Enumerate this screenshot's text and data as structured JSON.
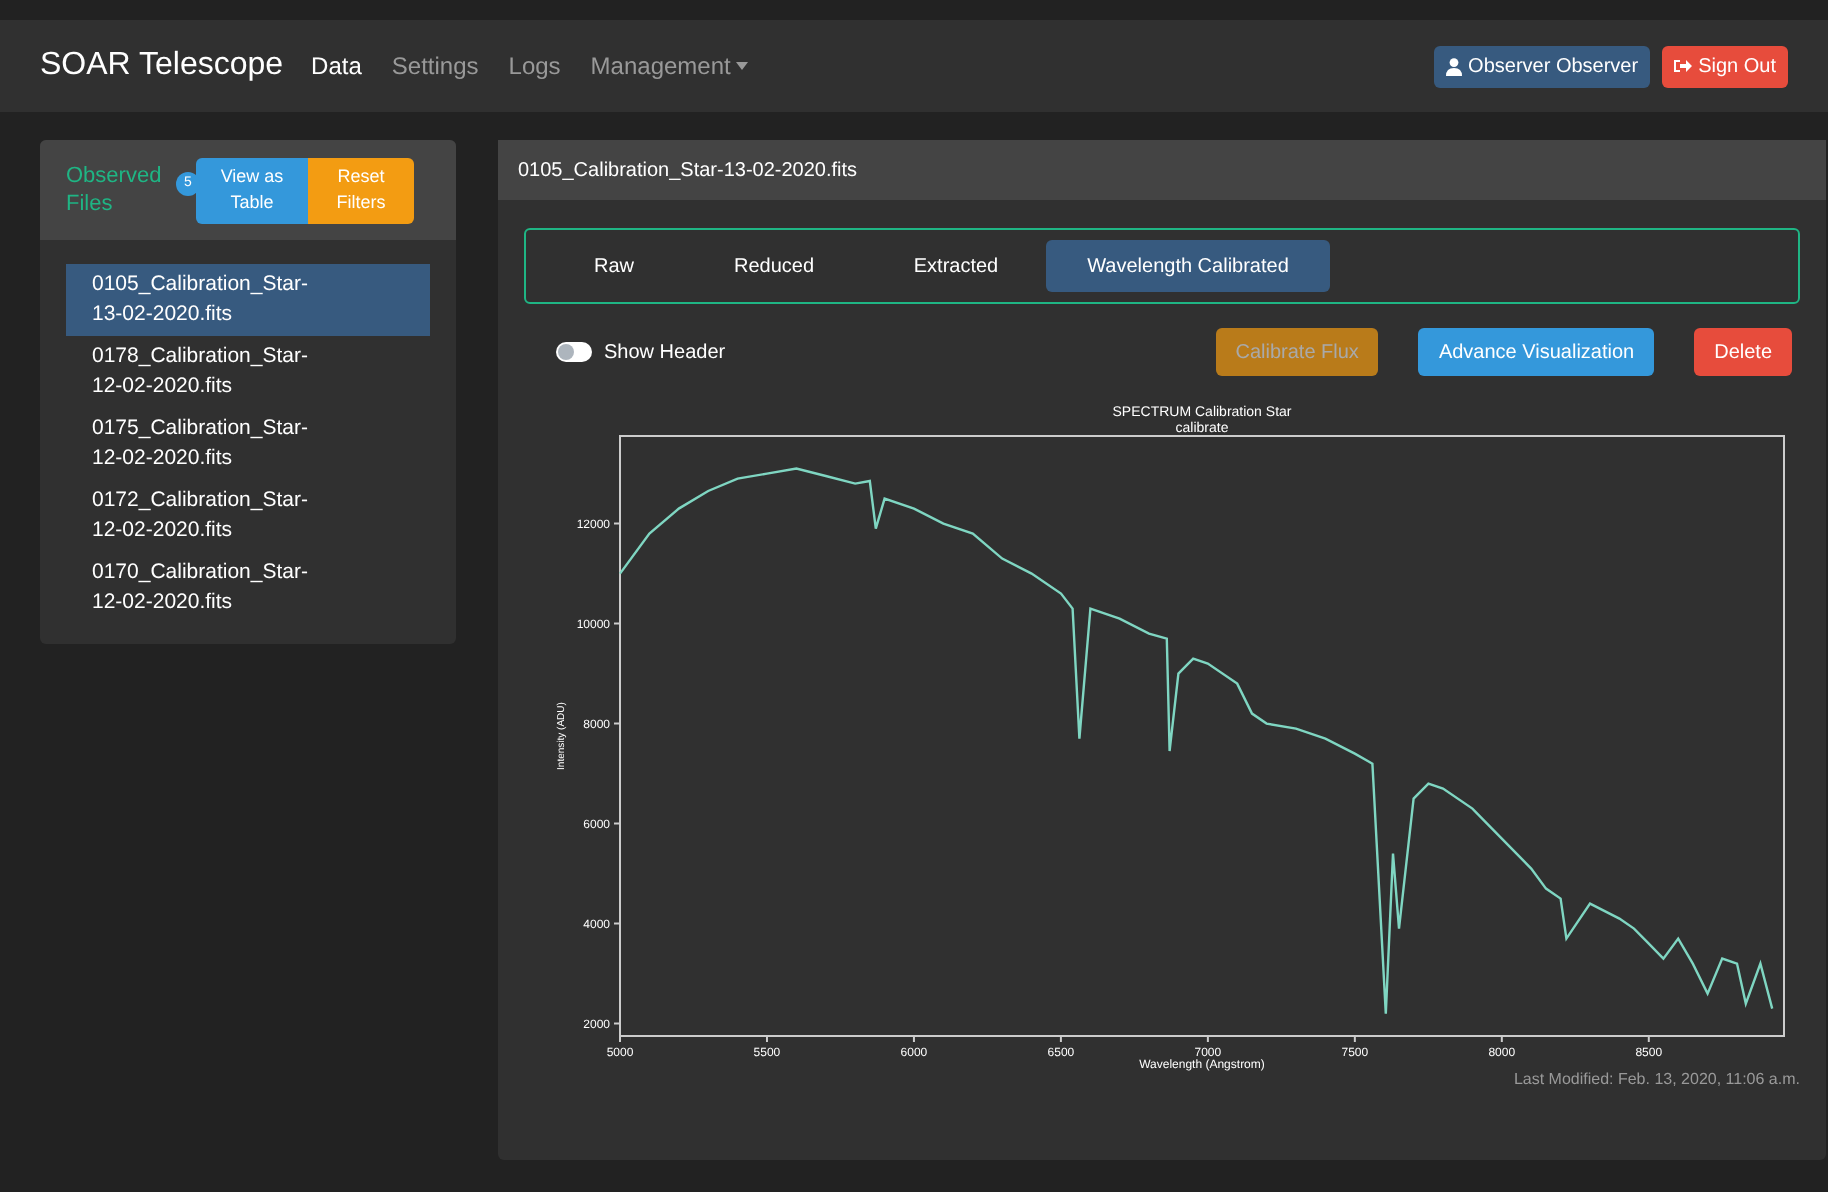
{
  "navbar": {
    "brand": "SOAR Telescope",
    "links": [
      {
        "label": "Data",
        "selected": true
      },
      {
        "label": "Settings",
        "selected": false
      },
      {
        "label": "Logs",
        "selected": false
      },
      {
        "label": "Management",
        "selected": false,
        "kind": "dropdown"
      }
    ],
    "user_button": "Observer Observer",
    "signout_button": "Sign Out"
  },
  "sidebar": {
    "title": "Observed Files",
    "count": "5",
    "view_button": "View as Table",
    "reset_button": "Reset Filters",
    "files": [
      {
        "label": "0105_Calibration_Star-13-02-2020.fits",
        "selected": true
      },
      {
        "label": "0178_Calibration_Star-12-02-2020.fits",
        "selected": false
      },
      {
        "label": "0175_Calibration_Star-12-02-2020.fits",
        "selected": false
      },
      {
        "label": "0172_Calibration_Star-12-02-2020.fits",
        "selected": false
      },
      {
        "label": "0170_Calibration_Star-12-02-2020.fits",
        "selected": false
      }
    ]
  },
  "main": {
    "title": "0105_Calibration_Star-13-02-2020.fits",
    "tabs": [
      {
        "label": "Raw",
        "selected": false
      },
      {
        "label": "Reduced",
        "selected": false
      },
      {
        "label": "Extracted",
        "selected": false
      },
      {
        "label": "Wavelength Calibrated",
        "selected": true
      }
    ],
    "show_header": {
      "label": "Show Header",
      "on": false
    },
    "buttons": [
      {
        "label": "Calibrate Flux",
        "kind": "warning",
        "disabled": true
      },
      {
        "label": "Advance Visualization",
        "kind": "info",
        "disabled": false
      },
      {
        "label": "Delete",
        "kind": "danger",
        "disabled": false
      }
    ],
    "chart_data": {
      "type": "line",
      "title": "SPECTRUM Calibration Star\ncalibrate",
      "xlabel": "Wavelength (Angstrom)",
      "ylabel": "Intensity (ADU)",
      "xlim": [
        5000,
        8960
      ],
      "ylim": [
        1750,
        13750
      ],
      "xticks": [
        5000,
        5500,
        6000,
        6500,
        7000,
        7500,
        8000,
        8500
      ],
      "yticks": [
        2000,
        4000,
        6000,
        8000,
        10000,
        12000
      ],
      "x": [
        5000,
        5100,
        5200,
        5300,
        5400,
        5500,
        5600,
        5700,
        5800,
        5850,
        5870,
        5900,
        6000,
        6100,
        6200,
        6300,
        6400,
        6500,
        6540,
        6563,
        6600,
        6700,
        6800,
        6860,
        6870,
        6900,
        6950,
        7000,
        7100,
        7150,
        7200,
        7300,
        7400,
        7500,
        7560,
        7605,
        7630,
        7650,
        7700,
        7750,
        7800,
        7900,
        8000,
        8100,
        8150,
        8200,
        8220,
        8300,
        8400,
        8450,
        8500,
        8550,
        8600,
        8650,
        8700,
        8750,
        8800,
        8830,
        8880,
        8920
      ],
      "series": [
        {
          "color": "#7fd6c2",
          "values": [
            11000,
            11800,
            12300,
            12650,
            12900,
            13000,
            13100,
            12950,
            12800,
            12850,
            11900,
            12500,
            12300,
            12000,
            11800,
            11300,
            11000,
            10600,
            10300,
            7700,
            10300,
            10100,
            9800,
            9700,
            7450,
            9000,
            9300,
            9200,
            8800,
            8200,
            8000,
            7900,
            7700,
            7400,
            7200,
            2200,
            5400,
            3900,
            6500,
            6800,
            6700,
            6300,
            5700,
            5100,
            4700,
            4500,
            3700,
            4400,
            4100,
            3900,
            3600,
            3300,
            3700,
            3200,
            2600,
            3300,
            3200,
            2400,
            3200,
            2300
          ]
        }
      ]
    },
    "last_modified": "Last Modified: Feb. 13, 2020, 11:06 a.m."
  }
}
